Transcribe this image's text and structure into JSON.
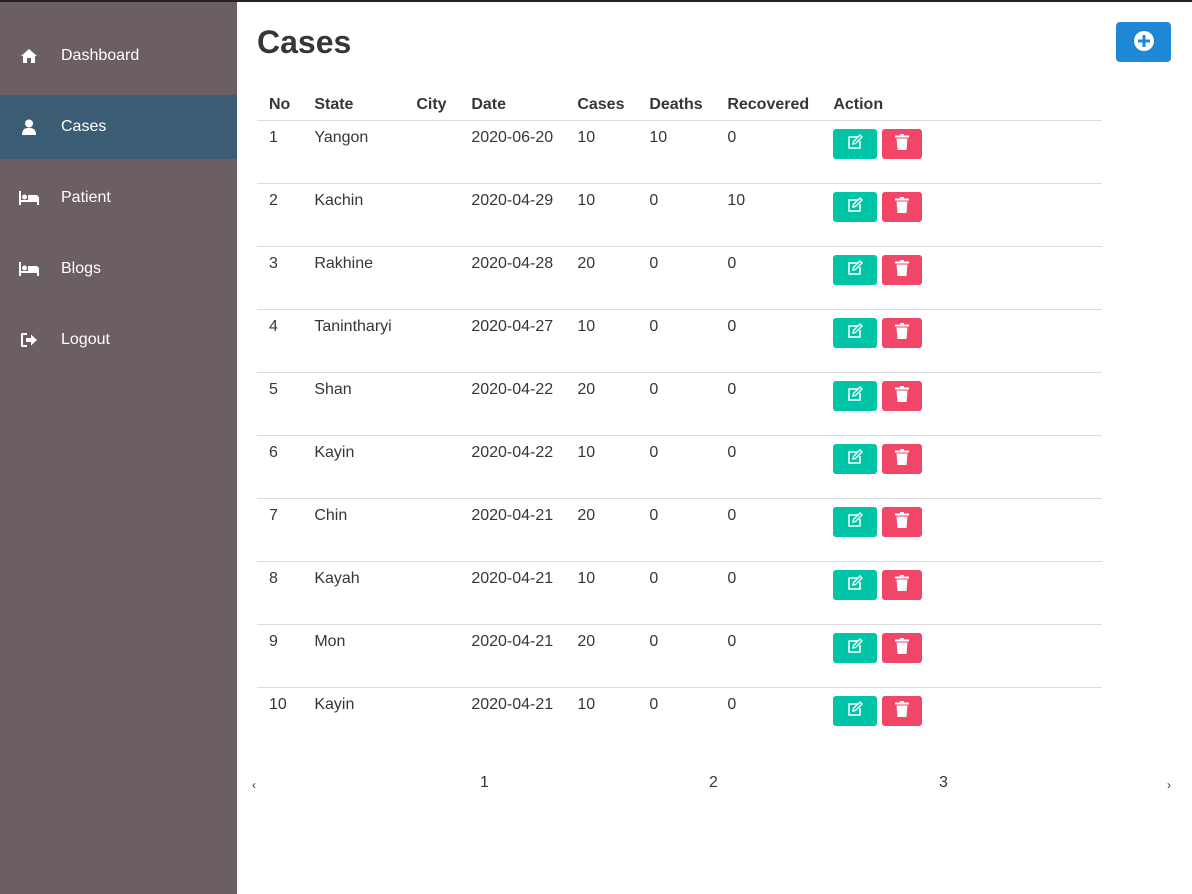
{
  "sidebar": {
    "items": [
      {
        "label": "Dashboard",
        "icon": "home-icon"
      },
      {
        "label": "Cases",
        "icon": "user-icon",
        "active": true
      },
      {
        "label": "Patient",
        "icon": "bed-icon"
      },
      {
        "label": "Blogs",
        "icon": "bed-icon"
      },
      {
        "label": "Logout",
        "icon": "sign-out-icon"
      }
    ]
  },
  "main": {
    "title": "Cases",
    "add_button_icon": "plus-circle-icon"
  },
  "table": {
    "headers": [
      "No",
      "State",
      "City",
      "Date",
      "Cases",
      "Deaths",
      "Recovered",
      "Action"
    ],
    "rows": [
      {
        "no": "1",
        "state": "Yangon",
        "city": "",
        "date": "2020-06-20",
        "cases": "10",
        "deaths": "10",
        "recovered": "0"
      },
      {
        "no": "2",
        "state": "Kachin",
        "city": "",
        "date": "2020-04-29",
        "cases": "10",
        "deaths": "0",
        "recovered": "10"
      },
      {
        "no": "3",
        "state": "Rakhine",
        "city": "",
        "date": "2020-04-28",
        "cases": "20",
        "deaths": "0",
        "recovered": "0"
      },
      {
        "no": "4",
        "state": "Tanintharyi",
        "city": "",
        "date": "2020-04-27",
        "cases": "10",
        "deaths": "0",
        "recovered": "0"
      },
      {
        "no": "5",
        "state": "Shan",
        "city": "",
        "date": "2020-04-22",
        "cases": "20",
        "deaths": "0",
        "recovered": "0"
      },
      {
        "no": "6",
        "state": "Kayin",
        "city": "",
        "date": "2020-04-22",
        "cases": "10",
        "deaths": "0",
        "recovered": "0"
      },
      {
        "no": "7",
        "state": "Chin",
        "city": "",
        "date": "2020-04-21",
        "cases": "20",
        "deaths": "0",
        "recovered": "0"
      },
      {
        "no": "8",
        "state": "Kayah",
        "city": "",
        "date": "2020-04-21",
        "cases": "10",
        "deaths": "0",
        "recovered": "0"
      },
      {
        "no": "9",
        "state": "Mon",
        "city": "",
        "date": "2020-04-21",
        "cases": "20",
        "deaths": "0",
        "recovered": "0"
      },
      {
        "no": "10",
        "state": "Kayin",
        "city": "",
        "date": "2020-04-21",
        "cases": "10",
        "deaths": "0",
        "recovered": "0"
      }
    ]
  },
  "pagination": {
    "prev": "‹",
    "pages": [
      "1",
      "2",
      "3"
    ],
    "next": "›"
  },
  "colors": {
    "sidebar_bg": "#6b5f63",
    "sidebar_active": "#3a5d74",
    "primary": "#1e88d6",
    "edit": "#00c4a7",
    "delete": "#f14668"
  }
}
